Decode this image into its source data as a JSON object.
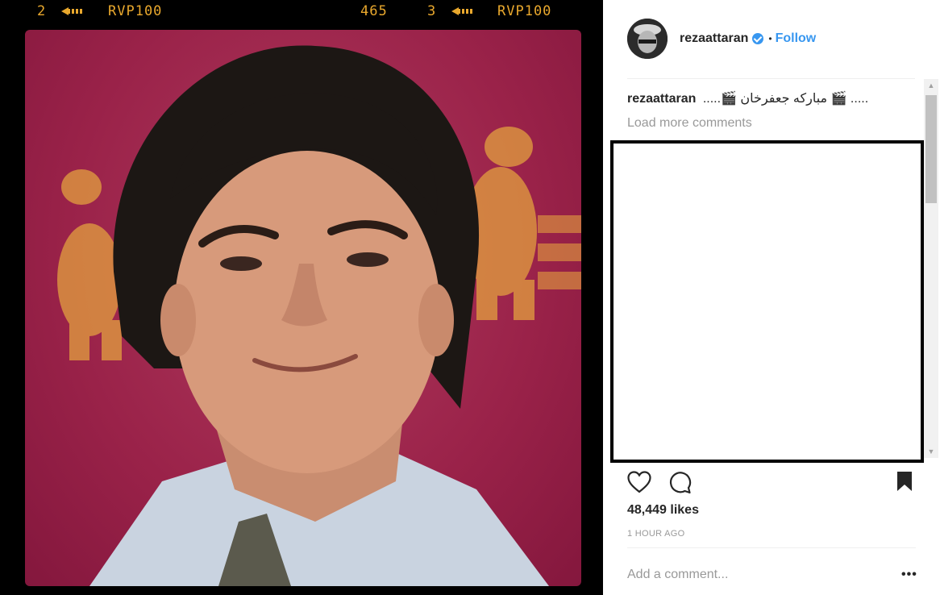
{
  "film_strip": {
    "left_frame_number": "2",
    "left_stock": "RVP100",
    "right_counter": "465",
    "right_frame_number": "3",
    "right_stock": "RVP100"
  },
  "post": {
    "username": "rezaattaran",
    "verified": true,
    "separator": "•",
    "follow_label": "Follow",
    "caption_username": "rezaattaran",
    "caption_text": ".....🎬 مبارکه جعفرخان 🎬 .....",
    "load_more_label": "Load more comments",
    "likes": "48,449 likes",
    "timestamp": "1 HOUR AGO",
    "add_comment_placeholder": "Add a comment...",
    "more_options": "•••"
  },
  "icons": {
    "like": "heart-icon",
    "comment": "comment-icon",
    "save": "bookmark-icon",
    "verified": "verified-badge-icon"
  },
  "colors": {
    "accent": "#3897f0",
    "background_red": "#9a2249",
    "film_text": "#e9a82d"
  }
}
